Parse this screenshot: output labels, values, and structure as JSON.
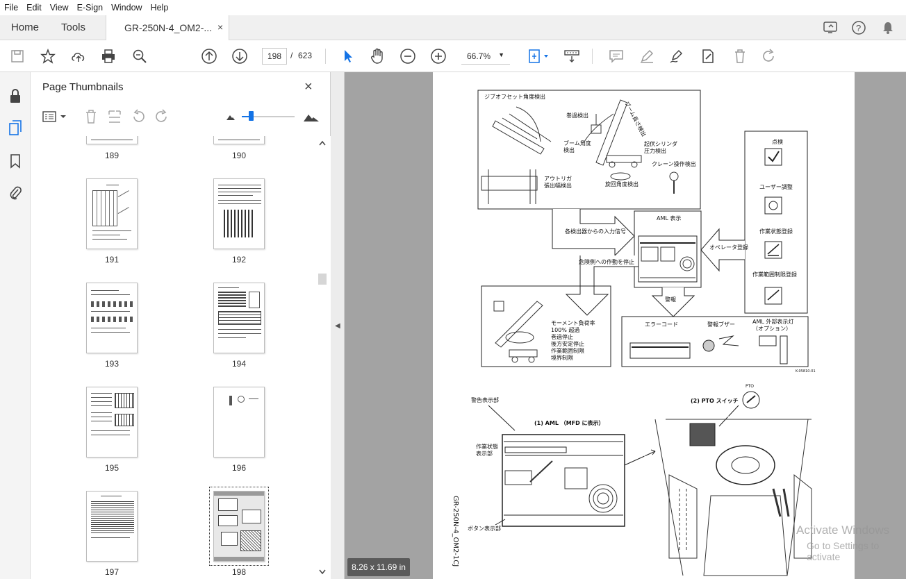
{
  "menu": [
    "File",
    "Edit",
    "View",
    "E-Sign",
    "Window",
    "Help"
  ],
  "tabs": {
    "home": "Home",
    "tools": "Tools",
    "document": "GR-250N-4_OM2-...",
    "close": "×"
  },
  "toolbar": {
    "current_page": "198",
    "separator": "/",
    "total_pages": "623",
    "zoom": "66.7%"
  },
  "panel": {
    "title": "Page Thumbnails",
    "close": "×",
    "thumbnails": [
      {
        "label": "189"
      },
      {
        "label": "190"
      },
      {
        "label": "191"
      },
      {
        "label": "192"
      },
      {
        "label": "193"
      },
      {
        "label": "194"
      },
      {
        "label": "195"
      },
      {
        "label": "196"
      },
      {
        "label": "197"
      },
      {
        "label": "198",
        "selected": true
      }
    ]
  },
  "document": {
    "page_size": "8.26 x 11.69 in",
    "labels": {
      "jib_offset": "ジブオフセット角度検出",
      "overwind": "巻過検出",
      "boom_length": "ブーム長さ検出",
      "boom_angle": "ブーム角度\n検出",
      "derrick_cyl": "起伏シリンダ\n圧力検出",
      "outrigger": "アウトリガ\n張出幅検出",
      "swing_angle": "旋回角度検出",
      "crane_op": "クレーン操作検出",
      "inputs": "各検出器からの入力信号",
      "aml_display": "AML 表示",
      "operator_reg": "オペレータ登録",
      "check": "点検",
      "user_adjust": "ユーザー調整",
      "work_state_reg": "作業状態登録",
      "work_range_reg": "作業範囲制限登録",
      "stop_danger": "危険側への作動を停止",
      "alarm": "警報",
      "moment": "モーメント負荷率\n100% 超過\n巻過停止\n後方安定停止\n作業範囲制限\n境界制限",
      "error_code": "エラーコード",
      "alarm_buzzer": "警報ブザー",
      "aml_ext_lamp": "AML 外部表示灯\n（オプション）",
      "fig_id": "K-05810-01",
      "warning_area": "警告表示部",
      "aml_mfd": "(1) AML （MFD に表示）",
      "work_state_area": "作業状態\n表示部",
      "button_area": "ボタン表示部",
      "pto_switch": "(2) PTO スイッチ",
      "pto": "PTO",
      "side_code": "GR-250N-4_OM2-1CJ"
    }
  },
  "watermark": {
    "line1": "Activate Windows",
    "line2": "Go to Settings to activate"
  },
  "colors": {
    "accent_blue": "#1473e6",
    "doc_background": "#a3a3a3"
  }
}
